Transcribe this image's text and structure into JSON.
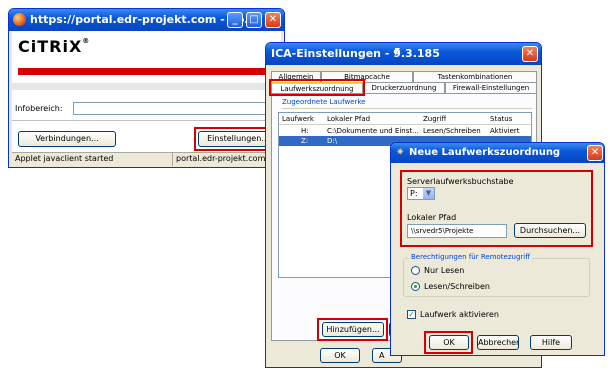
{
  "citrix_window": {
    "title": "https://portal.edr-projekt.com - Co...",
    "logo_text": "CiTRiX",
    "logo_mark": "®",
    "infobereich_label": "Infobereich:",
    "infobereich_value": "",
    "verbindungen_button": "Verbindungen...",
    "einstellungen_button": "Einstellungen...",
    "status_left": "Applet javaclient started",
    "status_right": "portal.edr-projekt.com"
  },
  "ica_window": {
    "title": "ICA-Einstellungen - 9.3.185",
    "tabs_row1": [
      "Allgemein",
      "Bitmapcache",
      "Tastenkombinationen"
    ],
    "tabs_row2": [
      "Laufwerkszuordnung",
      "Druckerzuordnung",
      "Firewall-Einstellungen"
    ],
    "section_title": "Zugeordnete Laufwerke",
    "columns": [
      "Laufwerk",
      "Lokaler Pfad",
      "Zugriff",
      "Status"
    ],
    "rows": [
      {
        "drive": "H:",
        "path": "C:\\Dokumente und Einst...",
        "access": "Lesen/Schreiben",
        "status": "Aktiviert"
      },
      {
        "drive": "Z:",
        "path": "D:\\",
        "access": "",
        "status": ""
      }
    ],
    "add_button": "Hinzufügen...",
    "ok_button": "OK",
    "apply_button": "A"
  },
  "drive_dialog": {
    "title": "Neue Laufwerkszuordnung",
    "server_letter_label": "Serverlaufwerksbuchstabe",
    "server_letter_value": "P:",
    "local_path_label": "Lokaler Pfad",
    "local_path_value": "\\\\srvedr5\\Projekte",
    "browse_button": "Durchsuchen...",
    "permissions_group": "Berechtigungen für Remotezugriff",
    "radio_read": "Nur Lesen",
    "radio_readwrite": "Lesen/Schreiben",
    "checkbox_enable": "Laufwerk aktivieren",
    "ok_button": "OK",
    "cancel_button": "Abbrechen",
    "help_button": "Hilfe"
  },
  "colors": {
    "xp_blue": "#0a58d8",
    "highlight_red": "#d40000",
    "selection": "#316ac5",
    "dialog_bg": "#ece9d8"
  }
}
